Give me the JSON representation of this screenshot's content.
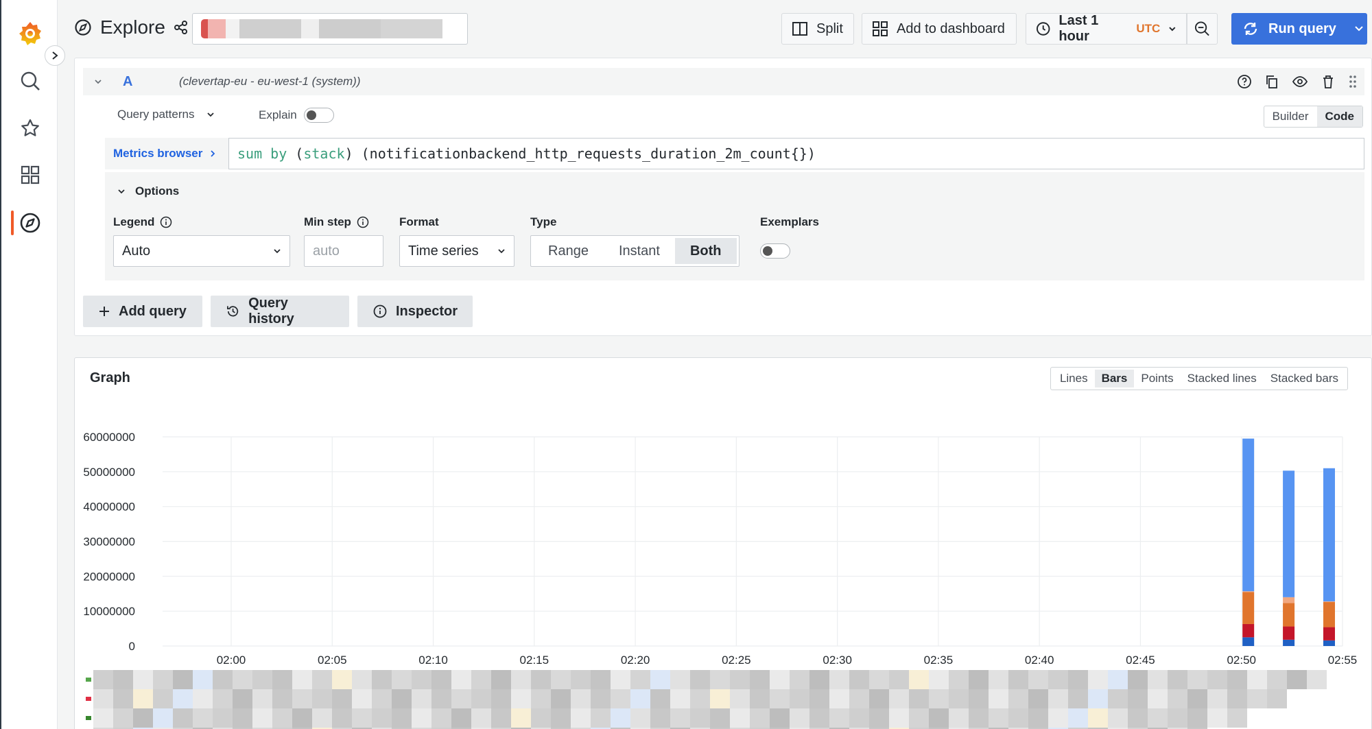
{
  "topbar": {
    "title": "Explore",
    "split": "Split",
    "add_dashboard": "Add to dashboard",
    "time_range": "Last 1 hour",
    "timezone": "UTC",
    "run_query": "Run query"
  },
  "query": {
    "ref": "A",
    "datasource": "(clevertap-eu - eu-west-1 (system))",
    "query_patterns": "Query patterns",
    "explain": "Explain",
    "builder": "Builder",
    "code": "Code",
    "metrics_browser": "Metrics browser",
    "expr_fn": "sum by",
    "expr_open": " (",
    "expr_label": "stack",
    "expr_rest": ") (notificationbackend_http_requests_duration_2m_count{})"
  },
  "options": {
    "header": "Options",
    "legend_label": "Legend",
    "legend_value": "Auto",
    "minstep_label": "Min step",
    "minstep_placeholder": "auto",
    "format_label": "Format",
    "format_value": "Time series",
    "type_label": "Type",
    "type_options": [
      "Range",
      "Instant",
      "Both"
    ],
    "type_selected": "Both",
    "exemplars_label": "Exemplars"
  },
  "actions": {
    "add_query": "Add query",
    "query_history": "Query history",
    "inspector": "Inspector"
  },
  "graph": {
    "title": "Graph",
    "modes": [
      "Lines",
      "Bars",
      "Points",
      "Stacked lines",
      "Stacked bars"
    ],
    "mode_selected": "Bars"
  },
  "colors": {
    "accent": "#3871dc",
    "brand": "#f05a28"
  },
  "chart_data": {
    "type": "bar",
    "stacked": true,
    "ylim": [
      0,
      60000000
    ],
    "yticks": [
      "60000000",
      "50000000",
      "40000000",
      "30000000",
      "20000000",
      "10000000",
      "0"
    ],
    "xticks": [
      "02:00",
      "02:05",
      "02:10",
      "02:15",
      "02:20",
      "02:25",
      "02:30",
      "02:35",
      "02:40",
      "02:45",
      "02:50",
      "02:55"
    ],
    "categories": [
      "02:51",
      "02:53",
      "02:55"
    ],
    "series": [
      {
        "color": "#1f60c4",
        "values": [
          2500000,
          1800000,
          1600000
        ]
      },
      {
        "color": "#c4162a",
        "values": [
          3800000,
          3800000,
          3800000
        ]
      },
      {
        "color": "#e0752d",
        "values": [
          9200000,
          6700000,
          7200000
        ]
      },
      {
        "color": "#f2a77f",
        "values": [
          200000,
          1700000,
          200000
        ]
      },
      {
        "color": "#5794f2",
        "values": [
          43800000,
          36300000,
          38200000
        ]
      }
    ],
    "grid": true
  }
}
